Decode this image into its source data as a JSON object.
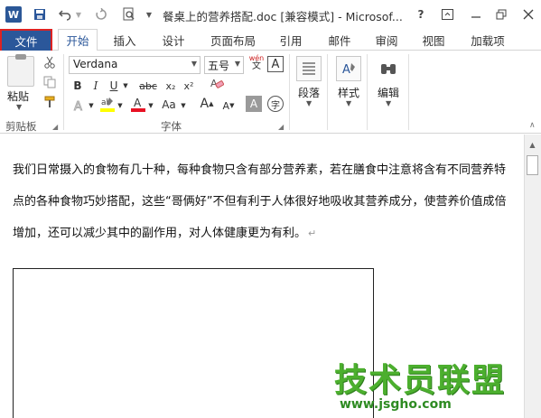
{
  "titlebar": {
    "app_logo": "W",
    "doc_title": "餐桌上的营养搭配.doc [兼容模式] - Microsof...",
    "help": "?",
    "icons": {
      "save": "save-icon",
      "undo": "undo-icon",
      "redo": "redo-icon",
      "preview": "print-preview-icon"
    }
  },
  "tabs": {
    "file": "文件",
    "items": [
      "开始",
      "插入",
      "设计",
      "页面布局",
      "引用",
      "邮件",
      "审阅",
      "视图",
      "加载项"
    ]
  },
  "ribbon": {
    "clipboard": {
      "paste_label": "粘贴",
      "group_label": "剪贴板"
    },
    "font": {
      "font_name": "Verdana",
      "font_size": "五号",
      "group_label": "字体",
      "bold": "B",
      "italic": "I",
      "underline": "U",
      "strike": "abc",
      "subscript": "x₂",
      "superscript": "x²",
      "change_case": "Aa",
      "grow": "A",
      "shrink": "A",
      "wen": "wén",
      "char_border": "A",
      "char_shade": "A",
      "enclose": "字"
    },
    "paragraph": {
      "label": "段落"
    },
    "styles": {
      "label": "样式"
    },
    "editing": {
      "label": "编辑"
    }
  },
  "document": {
    "paragraph": "我们日常摄入的食物有几十种，每种食物只含有部分营养素，若在膳食中注意将含有不同营养特点的各种食物巧妙搭配，这些“哥俩好”不但有利于人体很好地吸收其营养成分，使营养价值成倍增加，还可以减少其中的副作用，对人体健康更为有利。",
    "pilcrow": "↵"
  },
  "watermark": {
    "line1": "技术员联盟",
    "line2": "www.jsgho.com"
  },
  "colors": {
    "file_tab": "#2b579a",
    "highlight_yellow": "#ffff00",
    "font_red": "#e81123",
    "watermark_green": "#4caf2e"
  }
}
